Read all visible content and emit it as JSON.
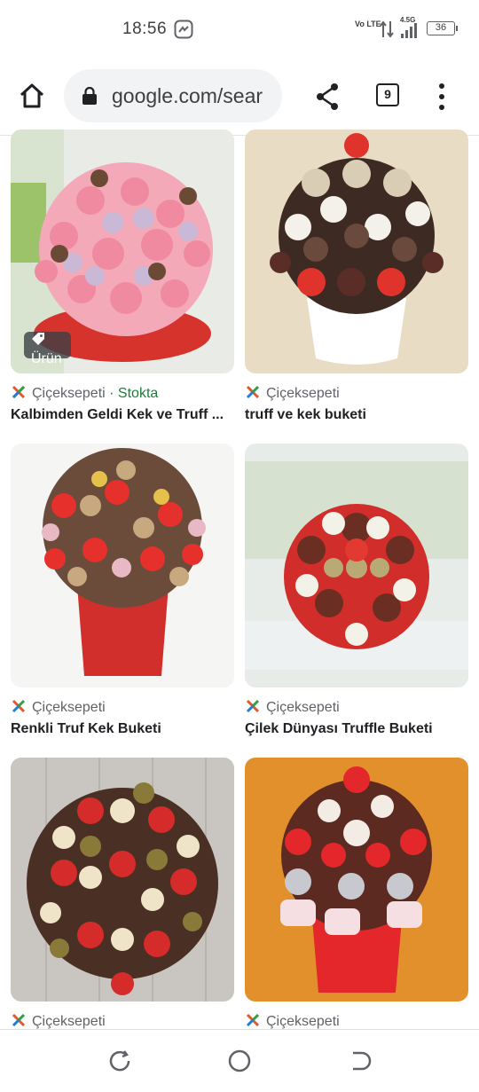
{
  "status": {
    "time": "18:56",
    "network_label": "Vo LTE",
    "signal_label": "4.5G",
    "battery": "36"
  },
  "browser": {
    "url": "google.com/sear",
    "tab_count": "9",
    "icons": {
      "home": "home-icon",
      "lock": "lock-icon",
      "share": "share-icon",
      "menu": "more-vert-icon"
    }
  },
  "results": [
    {
      "source": "Çiçeksepeti",
      "stock": "· Stokta",
      "title": "Kalbimden Geldi Kek ve Truff ...",
      "badge": "Ürün",
      "image": "pink-rose-truffle-bouquet"
    },
    {
      "source": "Çiçeksepeti",
      "title": "truff ve kek buketi",
      "image": "chocolate-truffle-bouquet-white-pot"
    },
    {
      "source": "Çiçeksepeti",
      "title": "Renkli Truf Kek Buketi",
      "image": "colorful-truffle-bouquet-red-pot"
    },
    {
      "source": "Çiçeksepeti",
      "title": "Çilek Dünyası Truffle Buketi",
      "image": "strawberry-truffle-arrangement"
    },
    {
      "source": "Çiçeksepeti",
      "title": "",
      "image": "truffle-balls-on-wood"
    },
    {
      "source": "Çiçeksepeti",
      "title": "",
      "image": "chocolate-strawberry-bouquet-red-pot"
    }
  ],
  "colors": {
    "accent_stock": "#188038",
    "urlbar_bg": "#f1f3f4",
    "badge_bg": "#3c4043"
  }
}
